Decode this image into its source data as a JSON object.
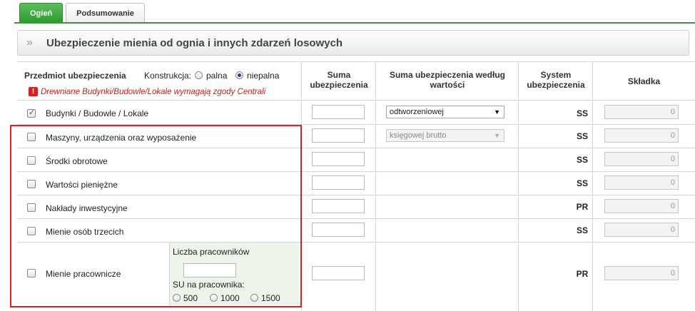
{
  "tabs": [
    {
      "label": "Ogień",
      "active": true
    },
    {
      "label": "Podsumowanie",
      "active": false
    }
  ],
  "section": {
    "title": "Ubezpieczenie mienia od ognia i innych zdarzeń losowych",
    "chevron": "»"
  },
  "header": {
    "subject": "Przedmiot ubezpieczenia",
    "construction_label": "Konstrukcja:",
    "construction_options": [
      {
        "label": "palna",
        "selected": false
      },
      {
        "label": "niepalna",
        "selected": true
      }
    ],
    "warning": "Drewniane Budynki/Budowle/Lokale wymagają zgody Centrali",
    "col_sum": [
      "Suma",
      "ubezpieczenia"
    ],
    "col_value": [
      "Suma ubezpieczenia według",
      "wartości"
    ],
    "col_system": [
      "System",
      "ubezpieczenia"
    ],
    "col_premium": "Składka"
  },
  "rows": [
    {
      "label": "Budynki / Budowle / Lokale",
      "checked": true,
      "select": "odtworzeniowej",
      "select_disabled": false,
      "system": "SS",
      "premium": "0"
    },
    {
      "label": "Maszyny, urządzenia oraz wyposażenie",
      "checked": false,
      "select": "księgowej brutto",
      "select_disabled": true,
      "system": "SS",
      "premium": "0"
    },
    {
      "label": "Środki obrotowe",
      "checked": false,
      "select": null,
      "system": "SS",
      "premium": "0"
    },
    {
      "label": "Wartości pieniężne",
      "checked": false,
      "select": null,
      "system": "SS",
      "premium": "0"
    },
    {
      "label": "Nakłady inwestycyjne",
      "checked": false,
      "select": null,
      "system": "PR",
      "premium": "0"
    },
    {
      "label": "Mienie osób trzecich",
      "checked": false,
      "select": null,
      "system": "SS",
      "premium": "0"
    },
    {
      "label": "Mienie pracownicze",
      "checked": false,
      "select": null,
      "system": "PR",
      "premium": "0"
    }
  ],
  "employees": {
    "count_label": "Liczba pracowników",
    "su_label": "SU na pracownika:",
    "options": [
      "500",
      "1000",
      "1500"
    ]
  },
  "colors": {
    "accent": "#3a9a3a",
    "warning": "#d51b1b",
    "highlight_border": "#e02020"
  }
}
